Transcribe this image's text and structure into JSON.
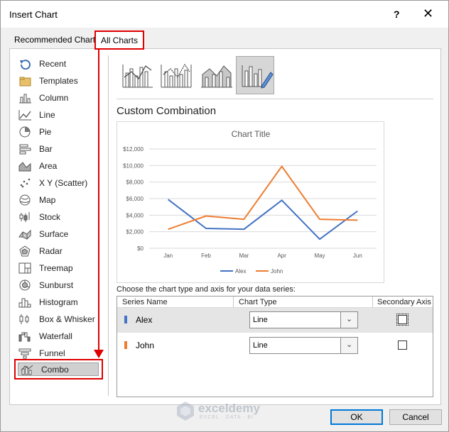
{
  "dialog": {
    "title": "Insert Chart",
    "help": "?",
    "close": "✕"
  },
  "tabs": [
    {
      "label": "Recommended Charts"
    },
    {
      "label": "All Charts"
    }
  ],
  "nav": [
    {
      "label": "Recent",
      "icon": "recent-icon"
    },
    {
      "label": "Templates",
      "icon": "templates-folder-icon"
    },
    {
      "label": "Column",
      "icon": "column-chart-icon"
    },
    {
      "label": "Line",
      "icon": "line-chart-icon"
    },
    {
      "label": "Pie",
      "icon": "pie-chart-icon"
    },
    {
      "label": "Bar",
      "icon": "bar-chart-icon"
    },
    {
      "label": "Area",
      "icon": "area-chart-icon"
    },
    {
      "label": "X Y (Scatter)",
      "icon": "scatter-chart-icon"
    },
    {
      "label": "Map",
      "icon": "map-chart-icon"
    },
    {
      "label": "Stock",
      "icon": "stock-chart-icon"
    },
    {
      "label": "Surface",
      "icon": "surface-chart-icon"
    },
    {
      "label": "Radar",
      "icon": "radar-chart-icon"
    },
    {
      "label": "Treemap",
      "icon": "treemap-chart-icon"
    },
    {
      "label": "Sunburst",
      "icon": "sunburst-chart-icon"
    },
    {
      "label": "Histogram",
      "icon": "histogram-chart-icon"
    },
    {
      "label": "Box & Whisker",
      "icon": "box-whisker-chart-icon"
    },
    {
      "label": "Waterfall",
      "icon": "waterfall-chart-icon"
    },
    {
      "label": "Funnel",
      "icon": "funnel-chart-icon"
    },
    {
      "label": "Combo",
      "icon": "combo-chart-icon",
      "selected": true
    }
  ],
  "main": {
    "section_title": "Custom Combination",
    "choose_label": "Choose the chart type and axis for your data series:",
    "table_headers": {
      "series": "Series Name",
      "type": "Chart Type",
      "axis": "Secondary Axis"
    },
    "series_rows": [
      {
        "name": "Alex",
        "color": "#4472c4",
        "type": "Line",
        "secondary_axis": false
      },
      {
        "name": "John",
        "color": "#ed7d31",
        "type": "Line",
        "secondary_axis": false
      }
    ]
  },
  "chart_data": {
    "type": "line",
    "title": "Chart Title",
    "categories": [
      "Jan",
      "Feb",
      "Mar",
      "Apr",
      "May",
      "Jun"
    ],
    "y_ticks": [
      "$12,000",
      "$10,000",
      "$8,000",
      "$6,000",
      "$4,000",
      "$2,000",
      "$0"
    ],
    "ylim": [
      0,
      12000
    ],
    "series": [
      {
        "name": "Alex",
        "color": "#4472c4",
        "values": [
          5900,
          2400,
          2300,
          5800,
          1100,
          4500
        ]
      },
      {
        "name": "John",
        "color": "#ed7d31",
        "values": [
          2300,
          3900,
          3500,
          9900,
          3500,
          3400
        ]
      }
    ],
    "legend": "bottom",
    "grid": true
  },
  "buttons": {
    "ok": "OK",
    "cancel": "Cancel"
  },
  "watermark": {
    "name": "exceldemy",
    "sub": "EXCEL · DATA · BI"
  }
}
